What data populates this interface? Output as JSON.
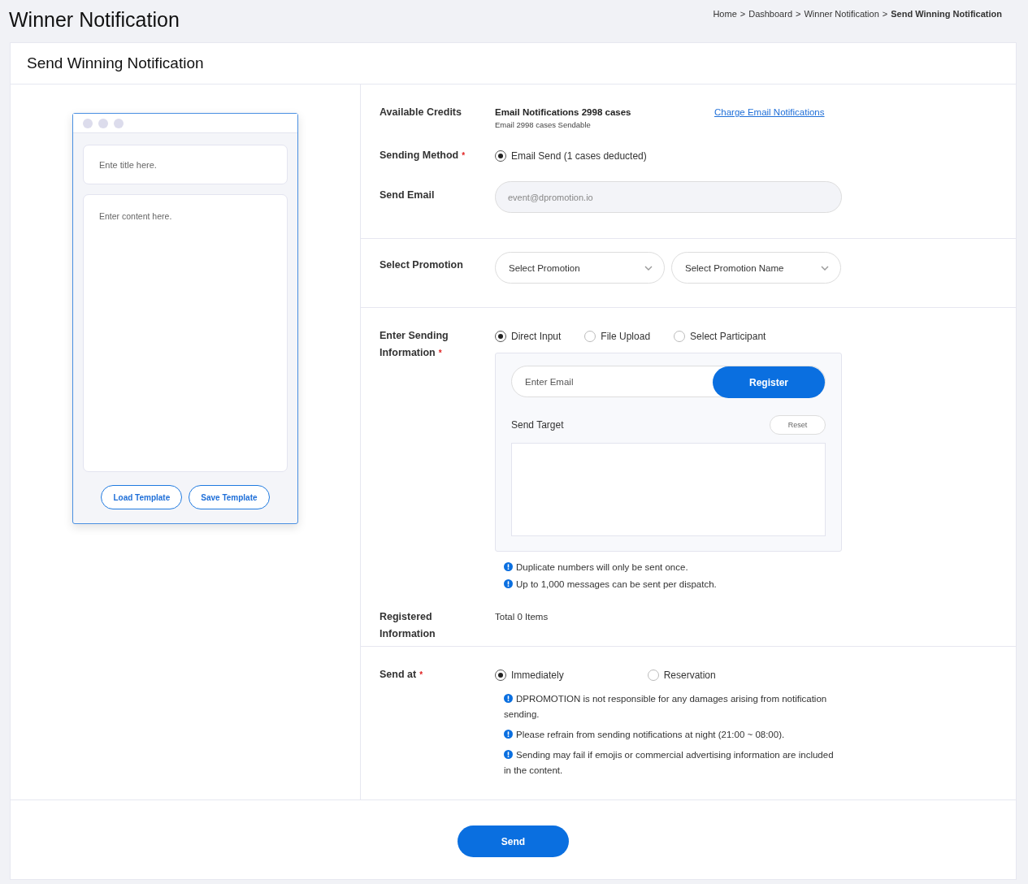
{
  "page_title": "Winner Notification",
  "breadcrumb": [
    {
      "label": "Home",
      "current": false
    },
    {
      "label": "Dashboard",
      "current": false
    },
    {
      "label": "Winner Notification",
      "current": false
    },
    {
      "label": "Send Winning Notification",
      "current": true
    }
  ],
  "breadcrumb_separator": ">",
  "card_title": "Send Winning Notification",
  "preview": {
    "title_placeholder": "Ente title here.",
    "content_placeholder": "Enter content here.",
    "buttons": [
      "Load Template",
      "Save Template"
    ]
  },
  "credits": {
    "label": "Available Credits",
    "summary": "Email Notifications 2998 cases",
    "detail": "Email 2998 cases Sendable",
    "link": "Charge Email Notifications"
  },
  "sending_method": {
    "label": "Sending Method",
    "required_mark": "*",
    "options": [
      {
        "label": "Email Send (1 cases deducted)",
        "selected": true
      }
    ]
  },
  "send_email": {
    "label": "Send Email",
    "value": "event@dpromotion.io",
    "disabled": true
  },
  "select_promotion": {
    "label": "Select Promotion",
    "selects": [
      "Select Promotion",
      "Select Promotion Name"
    ]
  },
  "sending_info": {
    "label": "Enter Sending Information",
    "required_mark": "*",
    "options": [
      {
        "label": "Direct Input",
        "selected": true
      },
      {
        "label": "File Upload",
        "selected": false
      },
      {
        "label": "Select Participant",
        "selected": false
      }
    ],
    "email_placeholder": "Enter Email",
    "register_button": "Register",
    "send_target_label": "Send Target",
    "reset_button": "Reset",
    "notes": [
      "Duplicate numbers will only be sent once.",
      "Up to 1,000 messages can be sent per dispatch."
    ]
  },
  "registered": {
    "label": "Registered Information",
    "value": "Total 0 Items"
  },
  "send_at": {
    "label": "Send at",
    "required_mark": "*",
    "options": [
      {
        "label": "Immediately",
        "selected": true
      },
      {
        "label": "Reservation",
        "selected": false
      }
    ],
    "notes": [
      "DPROMOTION is not responsible for any damages arising from notification sending.",
      "Please refrain from sending notifications at night (21:00 ~ 08:00).",
      "Sending may fail if emojis or commercial advertising information are included in the content."
    ]
  },
  "send_button": "Send"
}
